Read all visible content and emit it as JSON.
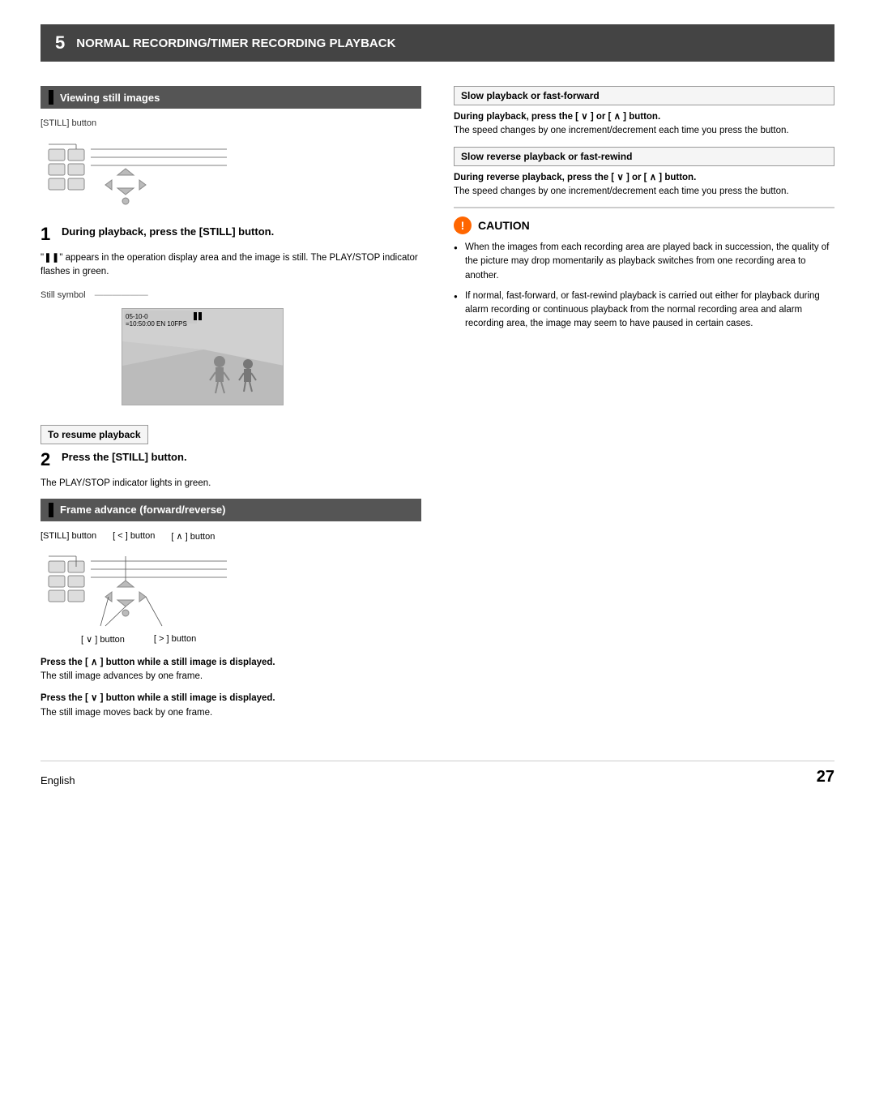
{
  "header": {
    "chapter": "5",
    "title": "NORMAL RECORDING/TIMER RECORDING PLAYBACK"
  },
  "left_col": {
    "section1": {
      "label": "Viewing still images",
      "still_button_label": "[STILL] button",
      "step1": {
        "num": "1",
        "text": "During playback, press the [STILL] button."
      },
      "step1_note": "\"❚❚\" appears in the operation display area and the image is still. The PLAY/STOP indicator flashes in green.",
      "still_symbol_label": "Still symbol",
      "still_preview_data": "05-10-0\n=10:50:00 EN   10FPS",
      "resume_box_label": "To resume playback",
      "step2": {
        "num": "2",
        "text": "Press the [STILL] button."
      },
      "step2_note": "The PLAY/STOP indicator lights in green."
    },
    "section2": {
      "label": "Frame advance (forward/reverse)",
      "still_button_label2": "[STILL] button",
      "less_button_label": "[ < ] button",
      "up_button_label": "[ ∧ ] button",
      "down_button_label": "[ ∨ ] button",
      "right_button_label": "[ > ] button",
      "forward_instruction": {
        "bold": "Press the [ ∧ ] button while a still image is displayed.",
        "normal": "The still image advances by one frame."
      },
      "reverse_instruction": {
        "bold": "Press the [ ∨ ] button while a still image is displayed.",
        "normal": "The still image moves back by one frame."
      }
    }
  },
  "right_col": {
    "section1": {
      "label": "Slow playback or fast-forward",
      "instruction_bold": "During playback, press the [ ∨ ] or [ ∧ ] button.",
      "instruction_normal": "The speed changes by one increment/decrement each time you press the button."
    },
    "section2": {
      "label": "Slow reverse playback or fast-rewind",
      "instruction_bold": "During reverse playback, press the [ ∨ ] or [ ∧ ] button.",
      "instruction_normal": "The speed changes by one increment/decrement each time you press the button."
    },
    "caution": {
      "title": "CAUTION",
      "items": [
        "When the images from each recording area are played back in succession, the quality of the picture may drop momentarily as playback switches from one recording area to another.",
        "If normal, fast-forward, or fast-rewind playback is carried out either for playback during alarm recording or continuous playback from the normal recording area and alarm recording area, the image may seem to have paused in certain cases."
      ]
    }
  },
  "footer": {
    "language": "English",
    "page_num": "27"
  }
}
